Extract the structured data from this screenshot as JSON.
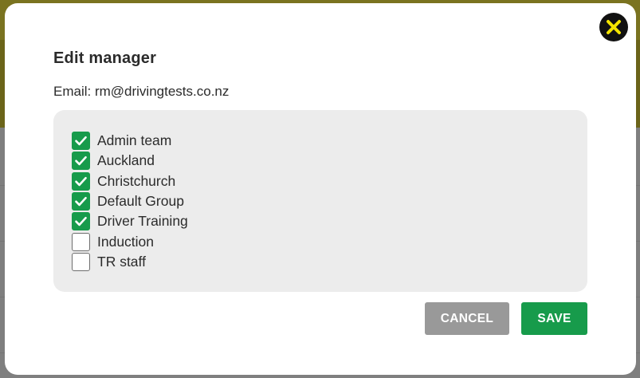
{
  "dialog": {
    "title": "Edit manager",
    "email_line": "Email: rm@drivingtests.co.nz"
  },
  "groups": [
    {
      "label": "Admin team",
      "checked": true
    },
    {
      "label": "Auckland",
      "checked": true
    },
    {
      "label": "Christchurch",
      "checked": true
    },
    {
      "label": "Default Group",
      "checked": true
    },
    {
      "label": "Driver Training",
      "checked": true
    },
    {
      "label": "Induction",
      "checked": false
    },
    {
      "label": "TR staff",
      "checked": false
    }
  ],
  "actions": {
    "cancel_label": "CANCEL",
    "save_label": "SAVE"
  },
  "colors": {
    "accent_green": "#179b4b",
    "cancel_gray": "#999999",
    "close_yellow": "#f3e400",
    "backdrop_header": "#6b6419"
  },
  "icons": {
    "close": "close-icon",
    "check": "checkmark-icon"
  }
}
